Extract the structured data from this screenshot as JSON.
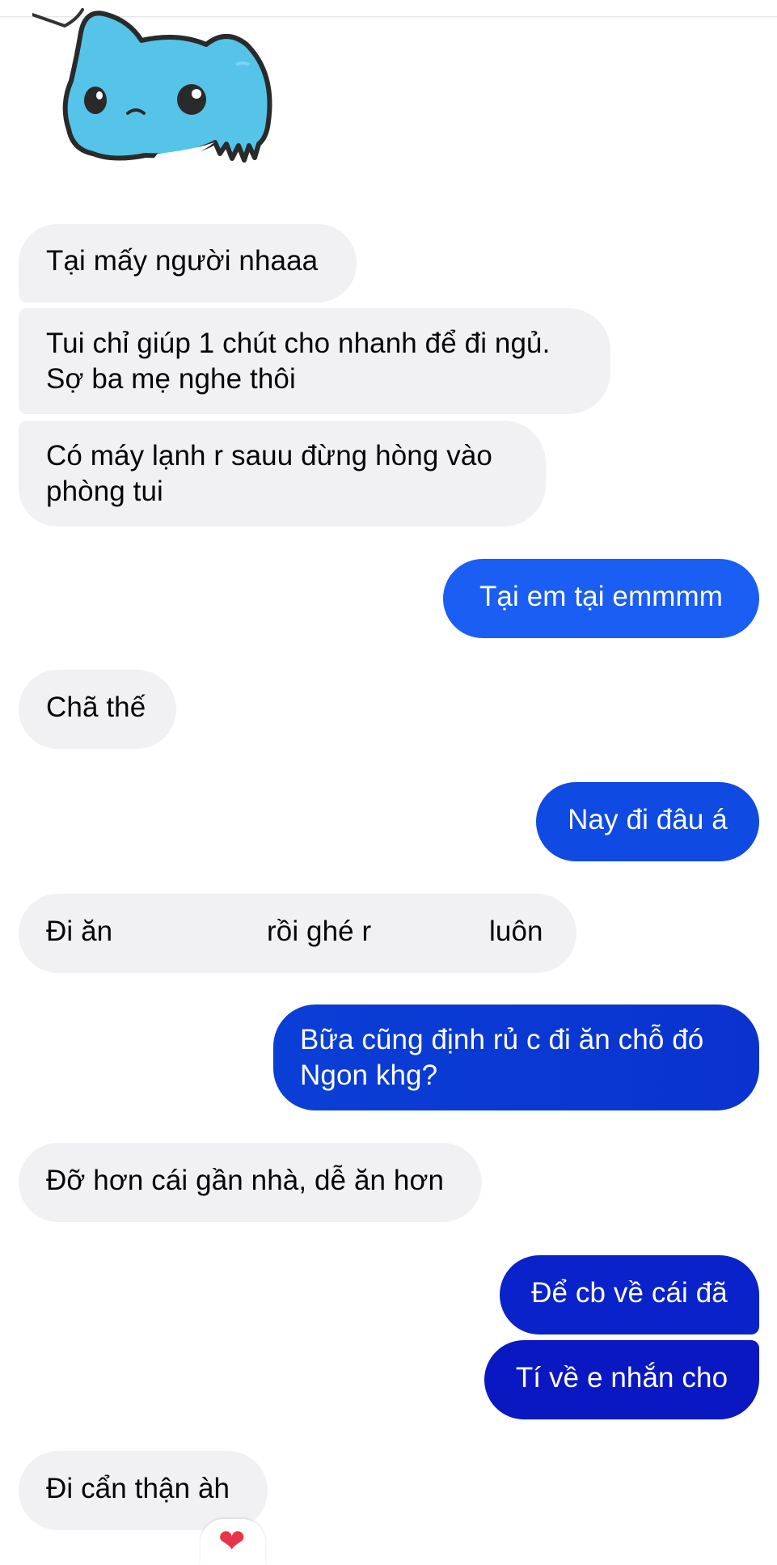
{
  "sticker": {
    "name": "blue-cat-sticker",
    "color": "#4ec6ea"
  },
  "messages": [
    {
      "from": "them",
      "text": "Tại mấy người nhaaa"
    },
    {
      "from": "them",
      "text": "Tui chỉ giúp 1 chút cho nhanh để đi ngủ.\nSợ ba mẹ nghe thôi"
    },
    {
      "from": "them",
      "text": "Có máy lạnh r sauu đừng hòng vào\nphòng tui"
    },
    {
      "from": "me",
      "text": "Tại em tại emmmm"
    },
    {
      "from": "them",
      "text": "Chã thế"
    },
    {
      "from": "me",
      "text": "Nay đi đâu á"
    },
    {
      "from": "them",
      "text_parts": [
        "Đi ăn",
        "rồi ghé r",
        "luôn"
      ]
    },
    {
      "from": "me",
      "text": "Bữa cũng định rủ c đi ăn chỗ đó\nNgon khg?"
    },
    {
      "from": "them",
      "text": "Đỡ hơn cái gần nhà, dễ ăn hơn"
    },
    {
      "from": "me",
      "text": "Để cb về cái đã"
    },
    {
      "from": "me",
      "text": "Tí về e nhắn cho"
    },
    {
      "from": "them",
      "text": "Đi cẩn thận àh"
    }
  ],
  "reaction": {
    "icon": "heart-icon",
    "glyph": "❤"
  },
  "colors": {
    "incoming_bg": "#f1f1f4",
    "outgoing_gradient": [
      "#1a63f2",
      "#0a3fd6",
      "#0a15c4"
    ]
  }
}
